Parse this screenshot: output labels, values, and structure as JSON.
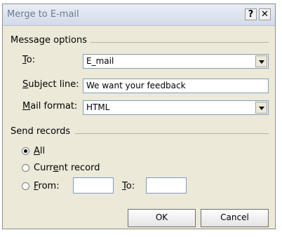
{
  "window": {
    "title": "Merge to E-mail",
    "help_glyph": "?",
    "close_glyph": "✕"
  },
  "message_options": {
    "legend": "Message options",
    "to_label": "To:",
    "to_value": "E_mail",
    "subject_label": "Subject line:",
    "subject_value": "We want your feedback",
    "format_label": "Mail format:",
    "format_value": "HTML"
  },
  "send_records": {
    "legend": "Send records",
    "options": [
      "All",
      "Current record",
      "From:"
    ],
    "selected": "All",
    "from_value": "",
    "to_label": "To:",
    "to_value": ""
  },
  "buttons": {
    "ok": "OK",
    "cancel": "Cancel"
  },
  "colors": {
    "dialog_bg": "#ece9d8",
    "title_text": "#6b7a96",
    "input_border": "#7f9db9"
  }
}
